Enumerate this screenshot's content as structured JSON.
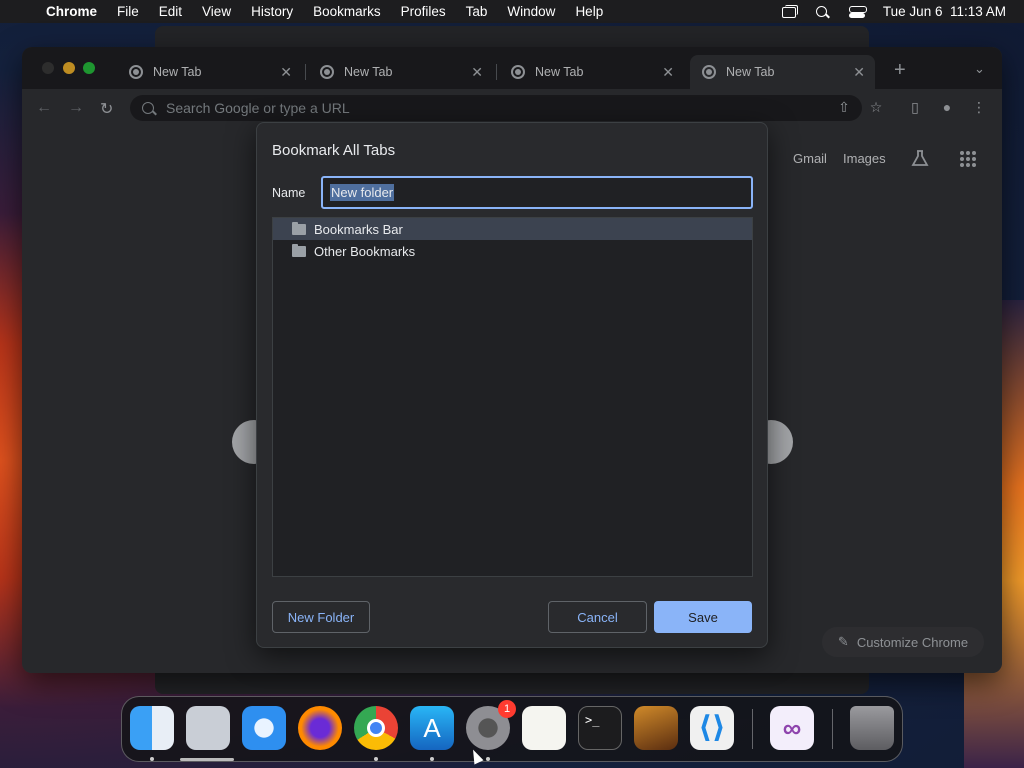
{
  "menubar": {
    "app": "Chrome",
    "items": [
      "File",
      "Edit",
      "View",
      "History",
      "Bookmarks",
      "Profiles",
      "Tab",
      "Window",
      "Help"
    ],
    "clock": "Tue Jun 6  11:13 AM"
  },
  "tabs": [
    {
      "label": "New Tab"
    },
    {
      "label": "New Tab"
    },
    {
      "label": "New Tab"
    },
    {
      "label": "New Tab"
    }
  ],
  "toolbar": {
    "omnibox_placeholder": "Search Google or type a URL"
  },
  "ntp": {
    "gmail": "Gmail",
    "images": "Images",
    "customize": "Customize Chrome"
  },
  "dialog": {
    "title": "Bookmark All Tabs",
    "name_label": "Name",
    "name_value": "New folder",
    "folders": [
      {
        "label": "Bookmarks Bar",
        "selected": true
      },
      {
        "label": "Other Bookmarks",
        "selected": false
      }
    ],
    "new_folder_label": "New Folder",
    "cancel_label": "Cancel",
    "save_label": "Save"
  },
  "dock": {
    "settings_badge": "1"
  },
  "colors": {
    "accent": "#8ab4f8",
    "dialog_bg": "#292a2d",
    "window_bg": "#35363a"
  }
}
